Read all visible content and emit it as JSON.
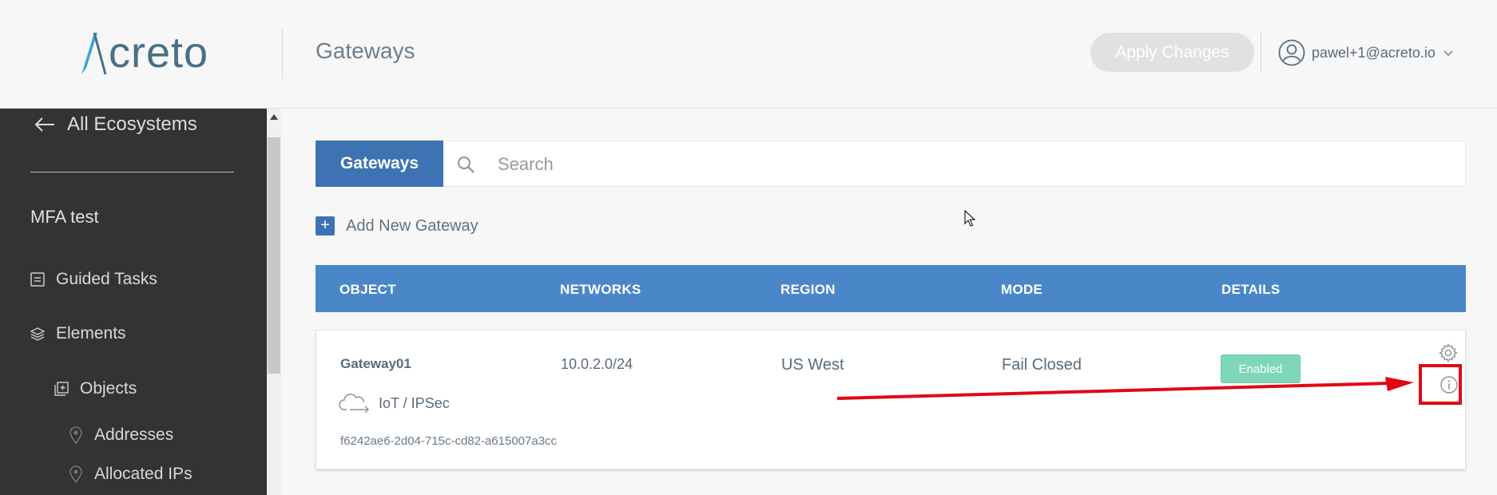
{
  "header": {
    "logo_text": "creto",
    "page_title": "Gateways",
    "apply_label": "Apply Changes",
    "user_email": "pawel+1@acreto.io"
  },
  "sidebar": {
    "back_label": "All Ecosystems",
    "ecosystem_name": "MFA test",
    "items": [
      {
        "label": "Guided Tasks",
        "icon": "list-icon"
      },
      {
        "label": "Elements",
        "icon": "layers-icon"
      },
      {
        "label": "Objects",
        "icon": "objects-icon"
      },
      {
        "label": "Addresses",
        "icon": "location-pin-icon"
      },
      {
        "label": "Allocated IPs",
        "icon": "location-pin-icon"
      }
    ]
  },
  "main": {
    "tab_label": "Gateways",
    "search_placeholder": "Search",
    "add_label": "Add New Gateway",
    "columns": [
      "OBJECT",
      "NETWORKS",
      "REGION",
      "MODE",
      "DETAILS"
    ],
    "rows": [
      {
        "name": "Gateway01",
        "type": "IoT / IPSec",
        "id": "f6242ae6-2d04-715c-cd82-a615007a3cc",
        "network": "10.0.2.0/24",
        "region": "US West",
        "mode": "Fail Closed",
        "status": "Enabled"
      }
    ]
  },
  "colors": {
    "brand_blue": "#3d73b3",
    "table_header": "#4a87c8",
    "enabled_badge": "#7ed7b8",
    "highlight_red": "#e30613",
    "sidebar_bg": "#333333"
  }
}
